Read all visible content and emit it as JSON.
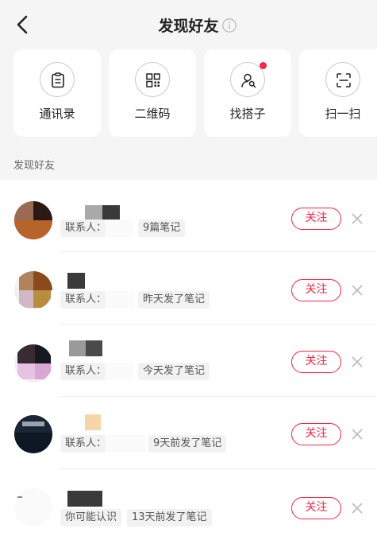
{
  "header": {
    "title": "发现好友"
  },
  "cards": [
    {
      "label": "通讯录",
      "icon": "contacts-clipboard-icon"
    },
    {
      "label": "二维码",
      "icon": "qr-code-icon"
    },
    {
      "label": "找搭子",
      "icon": "find-partner-icon",
      "badge_color": "#ff2442"
    },
    {
      "label": "扫一扫",
      "icon": "scan-icon"
    }
  ],
  "section": {
    "title": "发现好友"
  },
  "friends": [
    {
      "source": "联系人：",
      "activity": "9篇笔记",
      "follow_label": "关注"
    },
    {
      "source": "联系人：",
      "activity": "昨天发了笔记",
      "follow_label": "关注"
    },
    {
      "source": "联系人：",
      "activity": "今天发了笔记",
      "follow_label": "关注"
    },
    {
      "source": "联系人：",
      "activity": "9天前发了笔记",
      "follow_label": "关注"
    },
    {
      "source": "你可能认识",
      "activity": "13天前发了笔记",
      "follow_label": "关注"
    }
  ],
  "colors": {
    "accent": "#ff2442",
    "background": "#f5f5f5",
    "card": "#ffffff"
  }
}
